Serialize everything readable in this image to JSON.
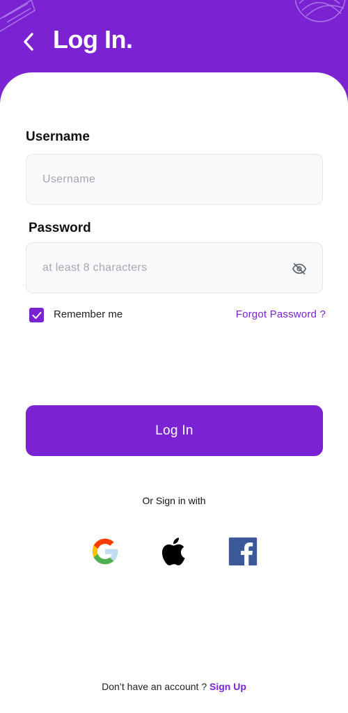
{
  "header": {
    "title": "Log In.",
    "back_icon": "chevron-left-icon"
  },
  "form": {
    "username": {
      "label": "Username",
      "placeholder": "Username",
      "value": ""
    },
    "password": {
      "label": "Password",
      "placeholder": "at least 8 characters",
      "value": "",
      "toggle_icon": "eye-off-icon"
    },
    "remember": {
      "label": "Remember me",
      "checked": true
    },
    "forgot_label": "Forgot Password ?"
  },
  "login_button": {
    "label": "Log In"
  },
  "social": {
    "prompt": "Or Sign in with",
    "providers": [
      "google-icon",
      "apple-icon",
      "facebook-icon"
    ]
  },
  "signup": {
    "prompt": "Don’t have an account ?",
    "link": "Sign Up"
  },
  "colors": {
    "primary": "#7B22D3",
    "input_bg": "#F7F9FB",
    "input_border": "#E4E7EB"
  }
}
